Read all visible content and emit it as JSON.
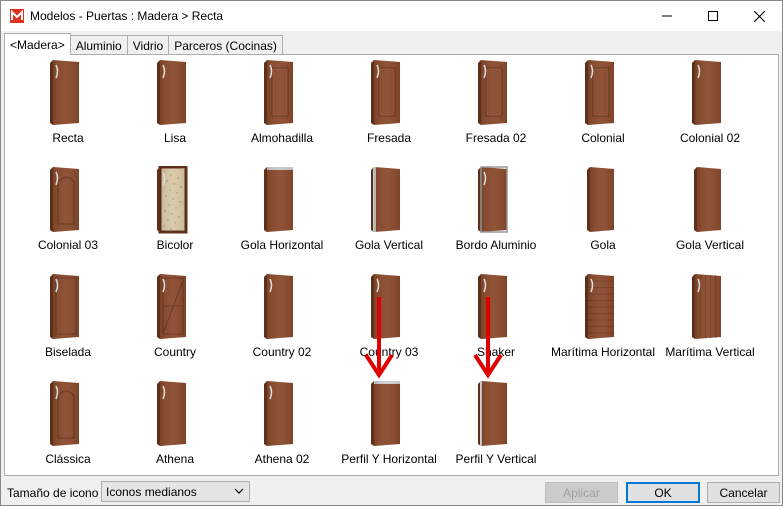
{
  "window": {
    "title": "Modelos - Puertas : Madera > Recta",
    "app_icon": "app-logo-icon",
    "controls": {
      "minimize": "minimize-icon",
      "maximize": "maximize-icon",
      "close": "close-icon"
    }
  },
  "tabs": [
    {
      "label": "<Madera>",
      "active": true
    },
    {
      "label": "Aluminio",
      "active": false
    },
    {
      "label": "Vidrio",
      "active": false
    },
    {
      "label": "Parceros (Cocinas)",
      "active": false
    }
  ],
  "items": [
    {
      "label": "Recta",
      "style": "plain"
    },
    {
      "label": "Lisa",
      "style": "plain"
    },
    {
      "label": "Almohadilla",
      "style": "raised"
    },
    {
      "label": "Fresada",
      "style": "raised"
    },
    {
      "label": "Fresada 02",
      "style": "raised"
    },
    {
      "label": "Colonial",
      "style": "raised"
    },
    {
      "label": "Colonial 02",
      "style": "plain"
    },
    {
      "label": "Colonial 03",
      "style": "arched"
    },
    {
      "label": "Bicolor",
      "style": "bicolor"
    },
    {
      "label": "Gola Horizontal",
      "style": "gola-h"
    },
    {
      "label": "Gola Vertical",
      "style": "gola-v"
    },
    {
      "label": "Bordo Aluminio",
      "style": "bordo"
    },
    {
      "label": "Gola",
      "style": "nohandle"
    },
    {
      "label": "Gola Vertical",
      "style": "nohandle"
    },
    {
      "label": "Biselada",
      "style": "bevel"
    },
    {
      "label": "Country",
      "style": "country"
    },
    {
      "label": "Country 02",
      "style": "plain"
    },
    {
      "label": "Country 03",
      "style": "plain"
    },
    {
      "label": "Shaker",
      "style": "plain"
    },
    {
      "label": "Marítima Horizontal",
      "style": "maritime-h"
    },
    {
      "label": "Marítima Vertical",
      "style": "maritime-v"
    },
    {
      "label": "Clássica",
      "style": "arched"
    },
    {
      "label": "Athena",
      "style": "plain"
    },
    {
      "label": "Athena 02",
      "style": "plain"
    },
    {
      "label": "Perfil Y Horizontal",
      "style": "perfil-h"
    },
    {
      "label": "Perfil Y Vertical",
      "style": "perfil-v"
    }
  ],
  "annotations": {
    "arrow_color": "#e00000"
  },
  "bottom": {
    "icon_size_label": "Tamaño de icono",
    "icon_size_value": "Iconos medianos",
    "apply_label": "Aplicar",
    "ok_label": "OK",
    "cancel_label": "Cancelar"
  },
  "colors": {
    "wood": "#8a4a2c",
    "wood_dark": "#5e2f1a",
    "wood_light": "#a8623f",
    "accent": "#0078d7"
  }
}
